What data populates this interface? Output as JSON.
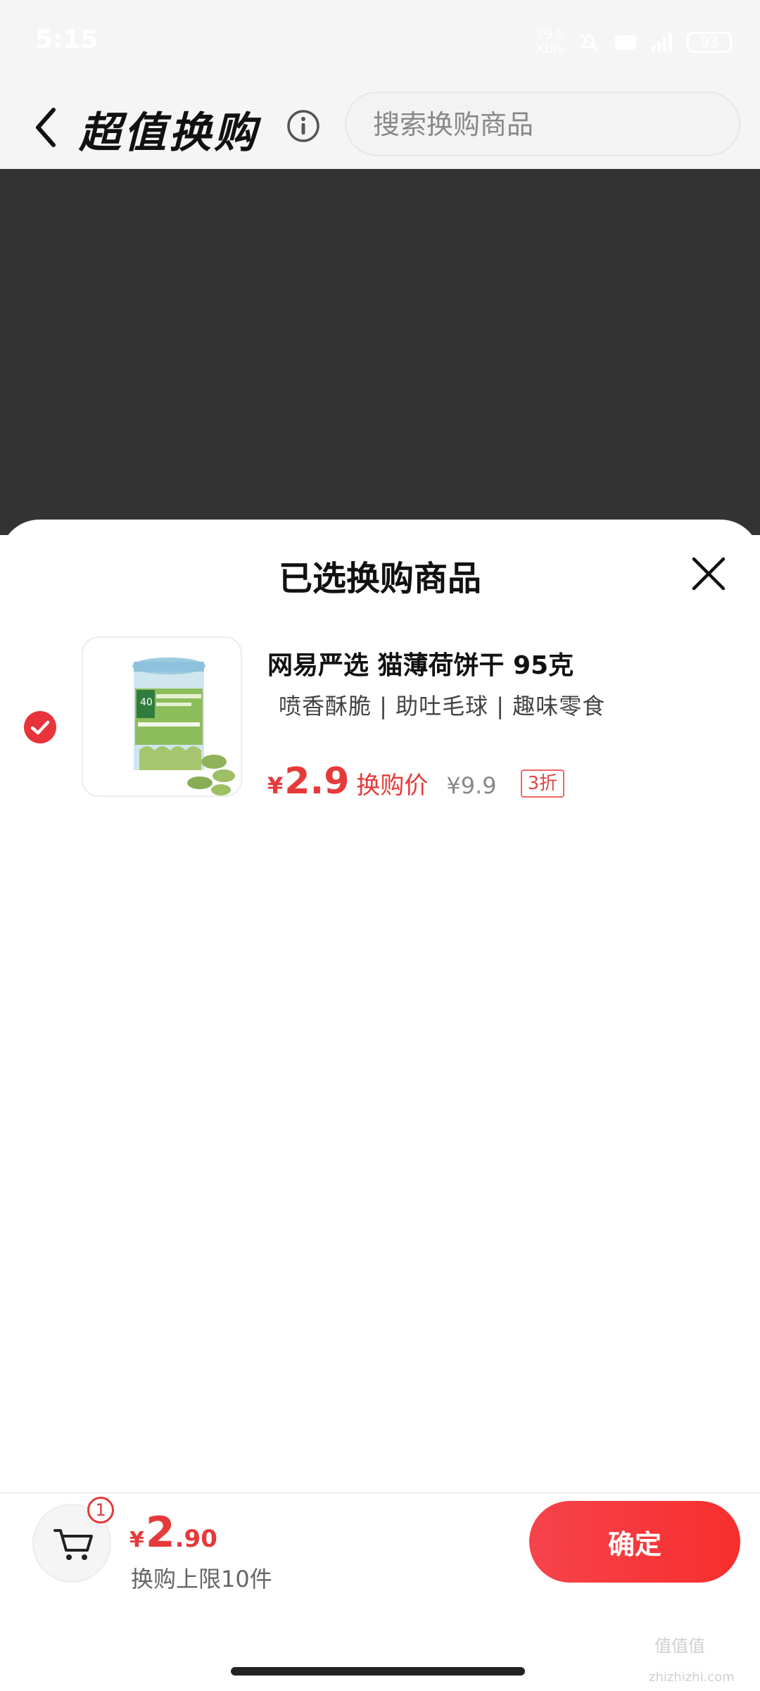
{
  "status_bar": {
    "time": "5:15",
    "speed_value": "79.5",
    "speed_unit": "KB/s",
    "battery": "93"
  },
  "header": {
    "title": "超值换购",
    "search_placeholder": "搜索换购商品"
  },
  "sheet": {
    "title": "已选换购商品",
    "item": {
      "name": "网易严选 猫薄荷饼干 95克",
      "tags": "喷香酥脆 | 助吐毛球 | 趣味零食",
      "currency": "¥",
      "price": "2.9",
      "price_label": "换购价",
      "original_price": "¥9.9",
      "discount": "3折",
      "product_label_number": "40"
    }
  },
  "bottom_bar": {
    "cart_count": "1",
    "currency": "¥",
    "total_integer": "2",
    "total_decimal": ".90",
    "limit_text": "换购上限10件",
    "confirm_label": "确定"
  },
  "watermark": {
    "text": "值值值",
    "url": "zhizhizhi.com"
  },
  "colors": {
    "accent": "#e63a3a",
    "overlay": "#333333",
    "header_bg": "#f5f5f5"
  }
}
